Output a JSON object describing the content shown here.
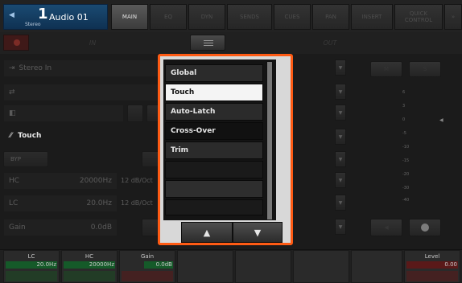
{
  "channel": {
    "number": "1",
    "stereo_label": "Stereo",
    "name": "Audio 01"
  },
  "tabs": [
    {
      "label": "MAIN"
    },
    {
      "label": "EQ"
    },
    {
      "label": "DYN"
    },
    {
      "label": "SENDS"
    },
    {
      "label": "CUES"
    },
    {
      "label": "PAN"
    },
    {
      "label": "INSERT"
    },
    {
      "label": "QUICK CONTROL"
    }
  ],
  "row2": {
    "in_label": "IN",
    "out_label": "OUT"
  },
  "left": {
    "input_name": "Stereo In",
    "automation_mode": "Touch",
    "bypass_label": "BYP",
    "hc": {
      "label": "HC",
      "value": "20000Hz",
      "slope": "12 dB/Oct"
    },
    "lc": {
      "label": "LC",
      "value": "20.0Hz",
      "slope": "12 dB/Oct"
    },
    "gain": {
      "label": "Gain",
      "value": "0.0dB"
    }
  },
  "right": {
    "mute_label": "M",
    "solo_label": "S",
    "scale": [
      "6",
      "3",
      "0",
      "-5",
      "-10",
      "-15",
      "-20",
      "-30",
      "-40"
    ]
  },
  "popup": {
    "items": [
      {
        "label": "Global",
        "state": "normal"
      },
      {
        "label": "Touch",
        "state": "selected"
      },
      {
        "label": "Auto-Latch",
        "state": "normal"
      },
      {
        "label": "Cross-Over",
        "state": "dark"
      },
      {
        "label": "Trim",
        "state": "normal"
      },
      {
        "label": "",
        "state": "empty"
      },
      {
        "label": "",
        "state": "filled"
      },
      {
        "label": "",
        "state": "empty"
      }
    ],
    "up_icon": "▲",
    "down_icon": "▼"
  },
  "bottom": {
    "lc": {
      "label": "LC",
      "value": "20.0Hz"
    },
    "hc": {
      "label": "HC",
      "value": "20000Hz"
    },
    "gain": {
      "label": "Gain",
      "value": "0.0dB"
    },
    "level": {
      "label": "Level",
      "value": "0.00"
    }
  },
  "colors": {
    "accent": "#ff5b14",
    "selected": "#f4f4f4",
    "channel_blue": "#1a4a72"
  }
}
